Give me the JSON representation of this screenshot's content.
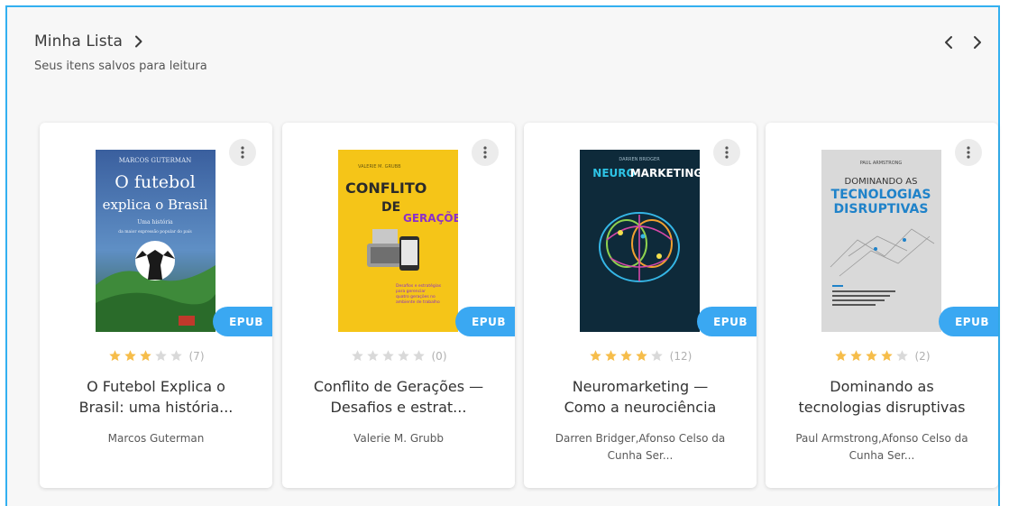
{
  "section": {
    "title": "Minha Lista",
    "subtitle": "Seus itens salvos para leitura",
    "title_icon": "chevron-right-icon",
    "nav_prev_icon": "chevron-left-icon",
    "nav_next_icon": "chevron-right-icon"
  },
  "colors": {
    "accent": "#3aa8f2",
    "frame_border": "#33b0f0",
    "star_filled": "#f6bd4a",
    "star_empty": "#d9d9d9"
  },
  "books": [
    {
      "title_line1": "O Futebol Explica o",
      "title_line2": "Brasil: uma história...",
      "author_line1": "Marcos Guterman",
      "author_line2": "",
      "format": "EPUB",
      "rating_count": "(7)",
      "stars": 3,
      "cover": {
        "author": "MARCOS GUTERMAN",
        "title_a": "O futebol",
        "title_b": "explica o Brasil",
        "sub_a": "Uma história",
        "sub_b": "da maior expressão popular do país"
      }
    },
    {
      "title_line1": "Conflito de Gerações —",
      "title_line2": "Desafios e estrat...",
      "author_line1": "Valerie M. Grubb",
      "author_line2": "",
      "format": "EPUB",
      "rating_count": "(0)",
      "stars": 0,
      "cover": {
        "author": "VALERIE M. GRUBB",
        "title_a": "CONFLITO",
        "title_b": "DE",
        "title_c": "GERAÇÕES",
        "sub_a": "Desafios e estratégias",
        "sub_b": "para gerenciar",
        "sub_c": "quatro gerações no",
        "sub_d": "ambiente de trabalho"
      }
    },
    {
      "title_line1": "Neuromarketing —",
      "title_line2": "Como a neurociência",
      "author_line1": "Darren Bridger,Afonso Celso da",
      "author_line2": "Cunha Ser...",
      "format": "EPUB",
      "rating_count": "(12)",
      "stars": 4,
      "cover": {
        "author": "DARREN BRIDGER",
        "title_a": "NEURO",
        "title_b": "MARKETING"
      }
    },
    {
      "title_line1": "Dominando as",
      "title_line2": "tecnologias disruptivas",
      "author_line1": "Paul Armstrong,Afonso Celso da",
      "author_line2": "Cunha Ser...",
      "format": "EPUB",
      "rating_count": "(2)",
      "stars": 4,
      "cover": {
        "author": "PAUL ARMSTRONG",
        "title_a": "DOMINANDO AS",
        "title_b": "TECNOLOGIAS",
        "title_c": "DISRUPTIVAS"
      }
    }
  ]
}
